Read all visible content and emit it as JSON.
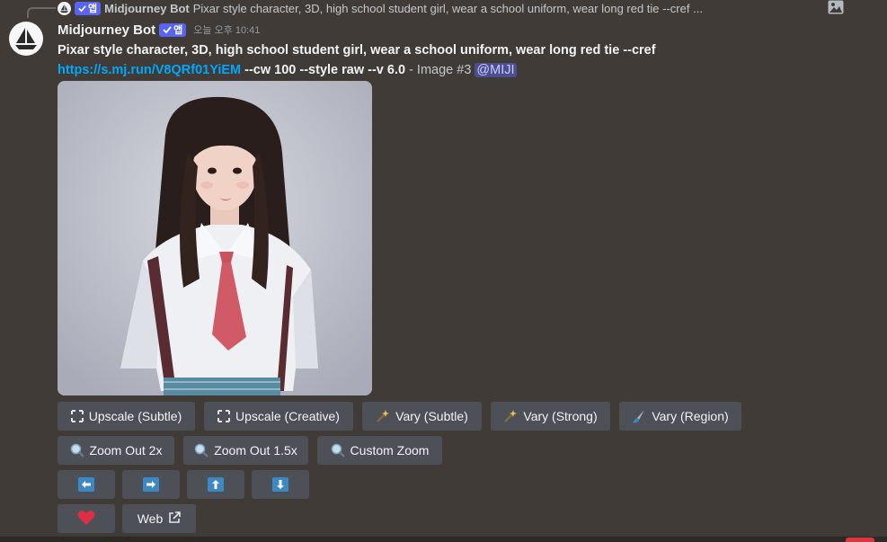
{
  "reply": {
    "badge_label": "앱",
    "author": "Midjourney Bot",
    "text": "Pixar style character, 3D, high school student girl, wear a school uniform, wear long red tie --cref ..."
  },
  "message": {
    "author": "Midjourney Bot",
    "badge_label": "앱",
    "timestamp": "오늘 오후 10:41",
    "prompt_bold": "Pixar style character, 3D, high school student girl, wear a school uniform, wear long red tie --cref",
    "link": "https://s.mj.run/V8QRf01YiEM",
    "params": " --cw 100 --style raw --v 6.0",
    "suffix": " - Image #3 ",
    "mention": "@MIJI"
  },
  "buttons": {
    "row1": [
      {
        "label": "Upscale (Subtle)",
        "icon": "expand-icon"
      },
      {
        "label": "Upscale (Creative)",
        "icon": "expand-icon"
      },
      {
        "label": "Vary (Subtle)",
        "icon": "magic-wand-icon"
      },
      {
        "label": "Vary (Strong)",
        "icon": "magic-wand-icon"
      },
      {
        "label": "Vary (Region)",
        "icon": "paintbrush-icon"
      }
    ],
    "row2": [
      {
        "label": "Zoom Out 2x",
        "icon": "magnifier-icon"
      },
      {
        "label": "Zoom Out 1.5x",
        "icon": "magnifier-icon"
      },
      {
        "label": "Custom Zoom",
        "icon": "magnifier-icon"
      }
    ],
    "pan": [
      "arrow-left-icon",
      "arrow-right-icon",
      "arrow-up-icon",
      "arrow-down-icon"
    ],
    "like_icon": "heart-icon",
    "web_label": "Web",
    "web_icon": "external-link-icon"
  },
  "colors": {
    "background": "#403b36",
    "button": "#4e5058",
    "link": "#00a8fc",
    "badge": "#5865f2"
  }
}
